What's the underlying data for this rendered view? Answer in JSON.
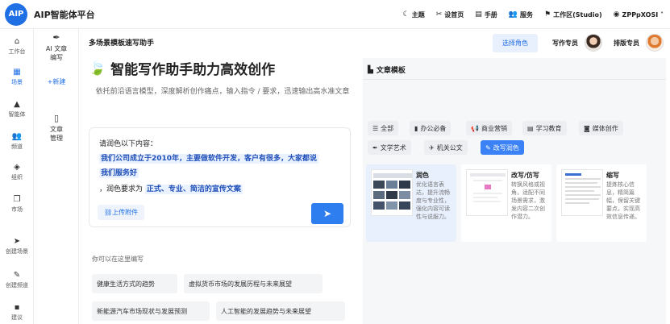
{
  "app": {
    "logo": "AIP",
    "name": "AIP智能体平台"
  },
  "topnav": [
    {
      "icon": "☾",
      "label": "主题"
    },
    {
      "icon": "✂",
      "label": "设首页"
    },
    {
      "icon": "▤",
      "label": "手册"
    },
    {
      "icon": "👥",
      "label": "服务"
    },
    {
      "icon": "⚑",
      "label": "工作区(Studio)"
    },
    {
      "icon": "◉",
      "label": "ZPPpXOSI ˅"
    }
  ],
  "sidebar": [
    {
      "icon": "⌂",
      "label": "工作台"
    },
    {
      "icon": "▦",
      "label": "场景"
    },
    {
      "icon": "▲",
      "label": "智能体"
    },
    {
      "icon": "👥",
      "label": "频道"
    },
    {
      "icon": "◈",
      "label": "组织"
    },
    {
      "icon": "❐",
      "label": "市场"
    },
    {
      "icon": "➤",
      "label": "创建场景"
    },
    {
      "icon": "✎",
      "label": "创建频道"
    },
    {
      "icon": "▪",
      "label": "建议"
    }
  ],
  "subnav": {
    "item1_icon": "✒",
    "item1_line1": "AI 文章",
    "item1_line2": "编写",
    "new_label": "+新建",
    "item2_icon": "▯",
    "item2_line1": "文章",
    "item2_line2": "管理"
  },
  "header": {
    "title": "多场景模板速写助手",
    "role_button": "选择角色",
    "writer_label": "写作专员",
    "layout_label": "排版专员"
  },
  "hero": {
    "icon": "🍃",
    "title": "智能写作助手助力高效创作",
    "subtitle": "依托前沿语言模型，深度解析创作痛点，输入指令 / 要求，迅速输出高水准文章"
  },
  "input": {
    "line1": "请润色以下内容：",
    "hl1": "我们公司成立于2010年，主要做软件开发，客户有很多，大家都说",
    "hl2": "我们服务好",
    "line3_prefix": "，润色要求为",
    "hl3": "正式、专业、简洁的宣传文案",
    "upload_label": "⛓上传附件",
    "send_icon": "➤"
  },
  "suggestions": {
    "hint": "你可以在这里编写",
    "items": [
      "健康生活方式的趋势",
      "虚拟货币市场的发展历程与未来展望",
      "新能源汽车市场现状与发展预测",
      "人工智能的发展趋势与未来展望"
    ]
  },
  "templates": {
    "title_icon": "▙",
    "title": "文章模板",
    "categories": [
      {
        "icon": "☰",
        "label": "全部"
      },
      {
        "icon": "▮",
        "label": "办公必备"
      },
      {
        "icon": "📢",
        "label": "商业营销"
      },
      {
        "icon": "▤",
        "label": "学习教育"
      },
      {
        "icon": "◙",
        "label": "媒体创作"
      },
      {
        "icon": "✒",
        "label": "文学艺术"
      },
      {
        "icon": "✈",
        "label": "机关公文"
      },
      {
        "icon": "✎",
        "label": "改写润色"
      }
    ],
    "cards": [
      {
        "name": "润色",
        "desc": "优化语言表达，提升流畅度与专业性，强化内容可读性与说服力。"
      },
      {
        "name": "改写/仿写",
        "desc": "转换风格或视角，适配不同场景需求，激发内容二次创作潜力。"
      },
      {
        "name": "缩写",
        "desc": "提炼核心信息，精简篇幅，保留关键要点，实现高效信息传递。"
      }
    ]
  }
}
